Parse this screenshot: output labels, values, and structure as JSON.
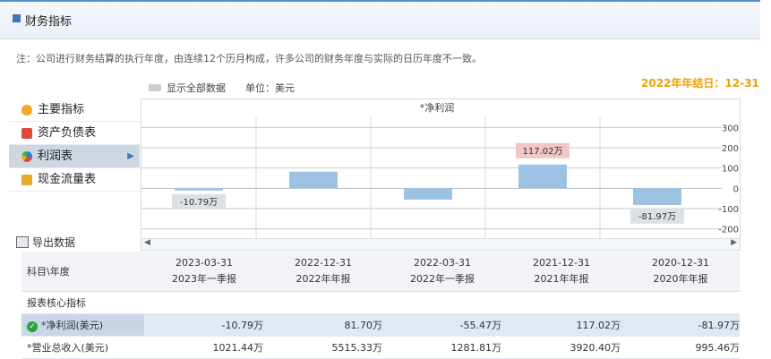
{
  "header": {
    "title": "财务指标"
  },
  "note": "注：公司进行财务结算的执行年度，由连续12个历月构成，许多公司的财务年度与实际的日历年度不一致。",
  "fiscal_year_end": "2022年年结日：12-31",
  "toolbar": {
    "show_all": "显示全部数据",
    "unit": "单位：美元"
  },
  "sidebar": {
    "items": [
      {
        "label": "主要指标",
        "icon": "sun-icon"
      },
      {
        "label": "资产负债表",
        "icon": "document-icon"
      },
      {
        "label": "利润表",
        "icon": "pie-icon"
      },
      {
        "label": "现金流量表",
        "icon": "cash-icon"
      }
    ],
    "export": "导出数据"
  },
  "chart_data": {
    "type": "bar",
    "title": "*净利润",
    "categories": [
      "2023-03-31",
      "2022-12-31",
      "2022-03-31",
      "2021-12-31",
      "2020-12-31"
    ],
    "values": [
      -10.79,
      81.7,
      -55.47,
      117.02,
      -81.97
    ],
    "labels": [
      "-10.79万",
      "",
      "",
      "117.02万",
      "-81.97万"
    ],
    "yticks": [
      300,
      200,
      100,
      0,
      -100,
      -200
    ],
    "ylim": [
      -250,
      350
    ]
  },
  "table": {
    "header_label": "科目\\年度",
    "columns": [
      {
        "date": "2023-03-31",
        "period": "2023年一季报"
      },
      {
        "date": "2022-12-31",
        "period": "2022年年报"
      },
      {
        "date": "2022-03-31",
        "period": "2022年一季报"
      },
      {
        "date": "2021-12-31",
        "period": "2021年年报"
      },
      {
        "date": "2020-12-31",
        "period": "2020年年报"
      }
    ],
    "section": "报表核心指标",
    "rows": [
      {
        "label": "*净利润(美元)",
        "values": [
          "-10.79万",
          "81.70万",
          "-55.47万",
          "117.02万",
          "-81.97万"
        ]
      },
      {
        "label": "*营业总收入(美元)",
        "values": [
          "1021.44万",
          "5515.33万",
          "1281.81万",
          "3920.40万",
          "995.46万"
        ]
      }
    ]
  }
}
